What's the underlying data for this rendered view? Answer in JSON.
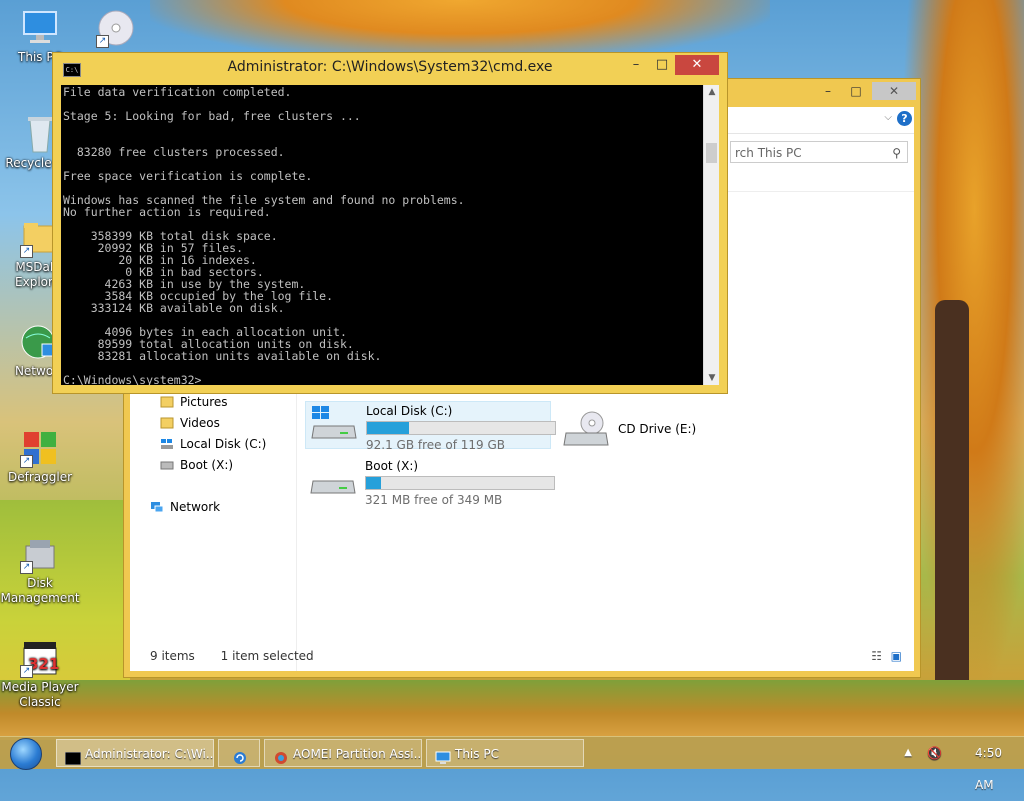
{
  "desktop": {
    "icons": [
      {
        "label": "This PC"
      },
      {
        "label": ""
      },
      {
        "label": "Recycle Bin"
      },
      {
        "label": "MSDaRT Explorer"
      },
      {
        "label": "Network"
      },
      {
        "label": "Defraggler"
      },
      {
        "label": "Disk Management"
      },
      {
        "label": "Media Player Classic"
      }
    ]
  },
  "cmd": {
    "title": "Administrator: C:\\Windows\\System32\\cmd.exe",
    "minimize": "–",
    "maximize": "□",
    "close": "✕",
    "output": "File data verification completed.\n\nStage 5: Looking for bad, free clusters ...\n\n\n  83280 free clusters processed.\n\nFree space verification is complete.\n\nWindows has scanned the file system and found no problems.\nNo further action is required.\n\n    358399 KB total disk space.\n     20992 KB in 57 files.\n        20 KB in 16 indexes.\n         0 KB in bad sectors.\n      4263 KB in use by the system.\n      3584 KB occupied by the log file.\n    333124 KB available on disk.\n\n      4096 bytes in each allocation unit.\n     89599 total allocation units on disk.\n     83281 allocation units available on disk.\n\nC:\\Windows\\system32>_"
  },
  "explorer": {
    "minimize": "–",
    "maximize": "□",
    "close": "✕",
    "search_placeholder": "rch This PC",
    "nav": [
      {
        "label": "Pictures",
        "icon": "pictures-icon"
      },
      {
        "label": "Videos",
        "icon": "videos-icon"
      },
      {
        "label": "Local Disk (C:)",
        "icon": "local-disk-icon"
      },
      {
        "label": "Boot (X:)",
        "icon": "drive-icon"
      },
      {
        "label": "Network",
        "icon": "network-icon"
      }
    ],
    "drives": [
      {
        "name": "Local Disk (C:)",
        "free": "92.1 GB free of 119 GB",
        "used_fraction": 0.226
      },
      {
        "name": "Boot (X:)",
        "free": "321 MB free of 349 MB",
        "used_fraction": 0.08
      },
      {
        "name": "CD Drive (E:)"
      }
    ],
    "status": {
      "items": "9 items",
      "selected": "1 item selected"
    }
  },
  "taskbar": {
    "tasks": [
      {
        "label": "Administrator: C:\\Wi..."
      },
      {
        "label": ""
      },
      {
        "label": "AOMEI Partition Assi..."
      },
      {
        "label": "This PC"
      }
    ],
    "clock": "4:50 AM"
  },
  "colors": {
    "accent": "#26a0da",
    "window_frame": "#f2d055",
    "close_red": "#c9473f"
  }
}
